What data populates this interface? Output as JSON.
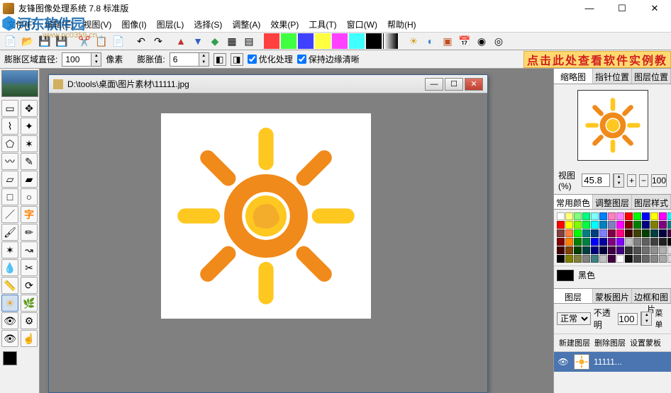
{
  "app": {
    "title": "友锋图像处理系统 7.8 标准版"
  },
  "window_controls": {
    "min": "—",
    "max": "☐",
    "close": "✕"
  },
  "watermark": {
    "logo_cn": "河东软件园",
    "url": "www.pc0359.cn"
  },
  "menu": [
    "文件(F)",
    "编辑(E)",
    "视图(V)",
    "图像(I)",
    "图层(L)",
    "选择(S)",
    "调整(A)",
    "效果(P)",
    "工具(T)",
    "窗口(W)",
    "帮助(H)"
  ],
  "banner": "点击此处查看软件实例教",
  "option_bar": {
    "label_radius": "膨胀区域直径:",
    "radius_value": "100",
    "label_pixel": "像素",
    "label_expand": "膨胀值:",
    "expand_value": "6",
    "check_opt": "优化处理",
    "check_edge": "保持边缘清晰"
  },
  "document": {
    "path": "D:\\tools\\桌面\\图片素材\\11111.jpg"
  },
  "right": {
    "tabs1": [
      "缩略图",
      "指针位置",
      "图层位置"
    ],
    "zoom_label": "视图(%)",
    "zoom_value": "45.8",
    "zoom_default": "100",
    "tabs2": [
      "常用颜色",
      "调整图层",
      "图层样式"
    ],
    "current_color_label": "黑色",
    "tabs3": [
      "图层",
      "蒙板图片",
      "边框和图片"
    ],
    "blend_mode": "正常",
    "opacity_label": "不透明",
    "opacity_value": "100",
    "menu_btn": "菜单",
    "layer_btns": [
      "新建图层",
      "删除图层",
      "设置蒙板"
    ],
    "layer_item": {
      "name": "11111..."
    }
  },
  "color_palette": [
    "#ffffff",
    "#ffff80",
    "#80ff80",
    "#00ff80",
    "#80ffff",
    "#0080ff",
    "#ff80c0",
    "#ff80ff",
    "#ff0000",
    "#00ff00",
    "#0000ff",
    "#ffff00",
    "#ff00ff",
    "#00ffff",
    "#ff0000",
    "#ffff00",
    "#80ff00",
    "#00ff40",
    "#00ffff",
    "#0080c0",
    "#8080c0",
    "#ff00ff",
    "#800000",
    "#008000",
    "#000080",
    "#808000",
    "#800080",
    "#008080",
    "#804040",
    "#ff8040",
    "#00ff00",
    "#008080",
    "#004080",
    "#8080ff",
    "#800040",
    "#ff0080",
    "#400000",
    "#404000",
    "#004000",
    "#004040",
    "#000040",
    "#400040",
    "#800000",
    "#ff8000",
    "#008000",
    "#008040",
    "#0000ff",
    "#0000a0",
    "#800080",
    "#8000ff",
    "#c0c0c0",
    "#808080",
    "#606060",
    "#404040",
    "#202020",
    "#000000",
    "#400000",
    "#804000",
    "#004000",
    "#004040",
    "#000080",
    "#000040",
    "#400040",
    "#400080",
    "#303030",
    "#505050",
    "#707070",
    "#909090",
    "#b0b0b0",
    "#e0e0e0",
    "#000000",
    "#808000",
    "#808040",
    "#808080",
    "#408080",
    "#c0c0c0",
    "#400040",
    "#ffffff",
    "#101010",
    "#484848",
    "#686868",
    "#888888",
    "#a8a8a8",
    "#d8d8d8"
  ],
  "tool_icons": [
    "rect-sel",
    "move",
    "lasso",
    "wand",
    "polygon-sel",
    "star-sel",
    "freehand",
    "pencil-yellow",
    "eraser",
    "paint-roller",
    "square",
    "ellipse",
    "line",
    "text",
    "brush",
    "pencil",
    "clone",
    "path",
    "dropper",
    "knife",
    "ruler",
    "rotate",
    "sun-tool",
    "plant",
    "eye",
    "cog",
    "redeye",
    "finger"
  ]
}
